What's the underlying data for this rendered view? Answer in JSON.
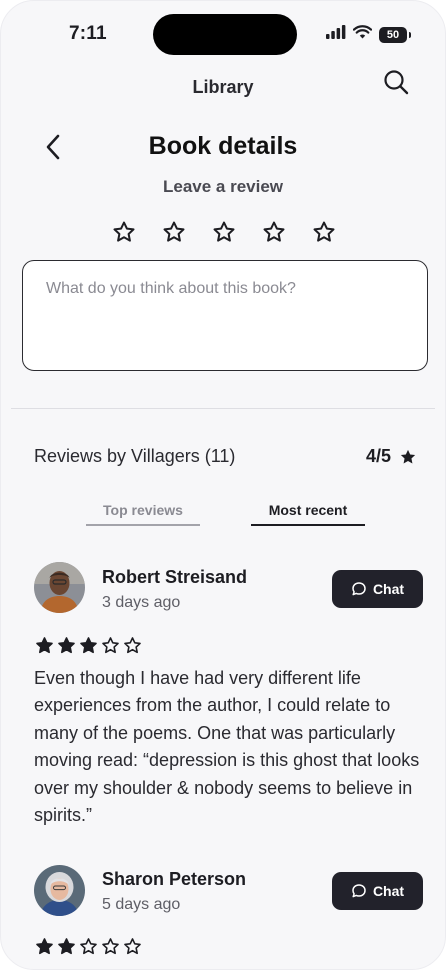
{
  "status_bar": {
    "time": "7:11",
    "battery": "50",
    "icons": [
      "signal-icon",
      "wifi-icon",
      "battery-icon"
    ]
  },
  "header": {
    "app_title": "Library",
    "search_icon": "search-icon"
  },
  "page": {
    "title": "Book details",
    "back_icon": "chevron-left-icon",
    "review_prompt": "Leave a review",
    "rating_input_max": 5,
    "review_placeholder": "What do you think about this book?"
  },
  "reviews_section": {
    "heading": "Reviews by Villagers (11)",
    "rating": "4/5",
    "rating_icon": "star-filled-icon",
    "tabs": [
      {
        "label": "Top reviews",
        "active": false
      },
      {
        "label": "Most recent",
        "active": true
      }
    ]
  },
  "reviews": [
    {
      "name": "Robert Streisand",
      "date": "3 days ago",
      "rating": 3,
      "max_rating": 5,
      "chat_label": "Chat",
      "text": "Even though I have had very different life experiences from the author, I could relate to many of the poems. One that was particularly moving read: “depression is this ghost that looks over my shoulder & nobody seems to believe in spirits.”"
    },
    {
      "name": "Sharon Peterson",
      "date": "5 days ago",
      "rating": 2,
      "max_rating": 5,
      "chat_label": "Chat",
      "text": ""
    }
  ],
  "colors": {
    "background": "#f7f7f9",
    "primary_dark": "#22222b",
    "muted_text": "#8a8a92"
  }
}
